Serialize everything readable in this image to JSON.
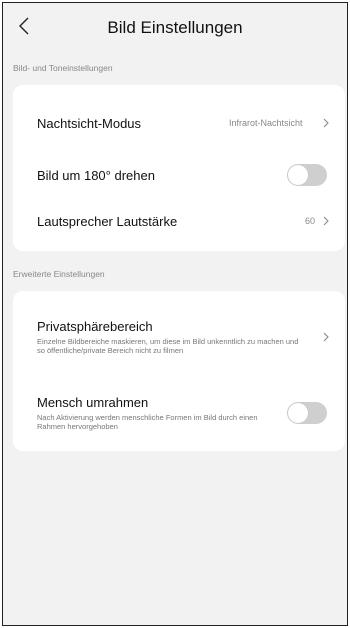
{
  "header": {
    "title": "Bild Einstellungen",
    "back_icon": "chevron-left-icon"
  },
  "sections": [
    {
      "label": "Bild- und Toneinstellungen",
      "rows": [
        {
          "label": "Nachtsicht-Modus",
          "value": "Infrarot-Nachtsicht",
          "type": "link"
        },
        {
          "label": "Bild um 180° drehen",
          "type": "toggle",
          "on": false
        },
        {
          "label": "Lautsprecher Lautstärke",
          "value": "60",
          "type": "link"
        }
      ]
    },
    {
      "label": "Erweiterte Einstellungen",
      "rows": [
        {
          "label": "Privatsphärebereich",
          "description": "Einzelne Bildbereiche maskieren, um diese im Bild unkenntlich zu machen und so öffentliche/private Bereich nicht zu filmen",
          "type": "link"
        },
        {
          "label": "Mensch umrahmen",
          "description": "Nach Aktivierung werden menschliche Formen im Bild durch einen Rahmen hervorgehoben",
          "type": "toggle",
          "on": false
        }
      ]
    }
  ],
  "colors": {
    "background": "#f2f2f2",
    "card": "#ffffff",
    "toggle_off": "#cfcfcf",
    "secondary_text": "#888888"
  }
}
